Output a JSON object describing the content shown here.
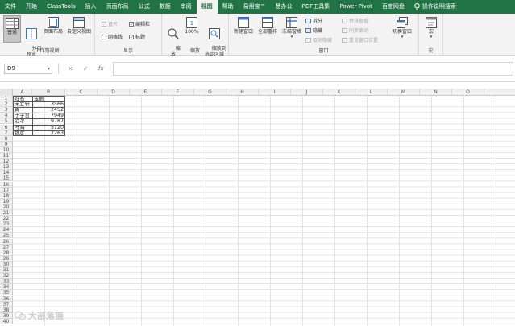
{
  "tabs": [
    "文件",
    "开始",
    "ClassTools",
    "插入",
    "页面布局",
    "公式",
    "数据",
    "审阅",
    "视图",
    "帮助",
    "易用宝™",
    "慧办公",
    "PDF工具集",
    "Power Pivot",
    "百度网盘"
  ],
  "active_tab_index": 8,
  "tell_me": "操作说明搜索",
  "ribbon": {
    "workbook_views": {
      "label": "工作簿视图",
      "normal": "普通",
      "page_break": "分页\n预览",
      "page_layout": "页面布局",
      "custom_views": "自定义视图"
    },
    "show": {
      "label": "显示",
      "ruler": "直尺",
      "formula_bar": "编辑栏",
      "gridlines": "网格线",
      "headings": "标题"
    },
    "zoom": {
      "label": "缩放",
      "zoom": "缩\n放",
      "hundred": "100%",
      "to_selection": "缩放到\n选定区域"
    },
    "window": {
      "label": "窗口",
      "new_window": "新建窗口",
      "arrange_all": "全部重排",
      "freeze_panes": "冻结窗格",
      "split": "拆分",
      "hide": "隐藏",
      "unhide": "取消隐藏",
      "side_by_side": "并排查看",
      "sync_scroll": "同步滚动",
      "reset_position": "重设窗口位置",
      "switch_windows": "切换窗口"
    },
    "macros": {
      "label": "宏",
      "macros": "宏"
    }
  },
  "formula_bar": {
    "name_box": "D9",
    "cancel": "✕",
    "enter": "✓",
    "fx": "fx",
    "content": ""
  },
  "columns": [
    "A",
    "B",
    "C",
    "D",
    "E",
    "F",
    "G",
    "H",
    "I",
    "J",
    "K",
    "L",
    "M",
    "N",
    "O"
  ],
  "rows": [
    "1",
    "2",
    "3",
    "4",
    "5",
    "6",
    "7",
    "8",
    "9",
    "10",
    "11",
    "12",
    "13",
    "14",
    "15",
    "16",
    "17",
    "18",
    "19",
    "20",
    "21",
    "22",
    "23",
    "24",
    "25",
    "26",
    "27",
    "28",
    "29",
    "30",
    "31",
    "32",
    "33",
    "34",
    "35",
    "36",
    "37",
    "38",
    "39",
    "40"
  ],
  "table": {
    "headers": [
      "姓名",
      "金额"
    ],
    "data": [
      [
        "宋立轩",
        "3566"
      ],
      [
        "黄一",
        "2452"
      ],
      [
        "于宇哲",
        "7949"
      ],
      [
        "范冰",
        "9787"
      ],
      [
        "叶海",
        "5120"
      ],
      [
        "魏彦",
        "2263"
      ]
    ]
  },
  "watermark": "大部落摄"
}
